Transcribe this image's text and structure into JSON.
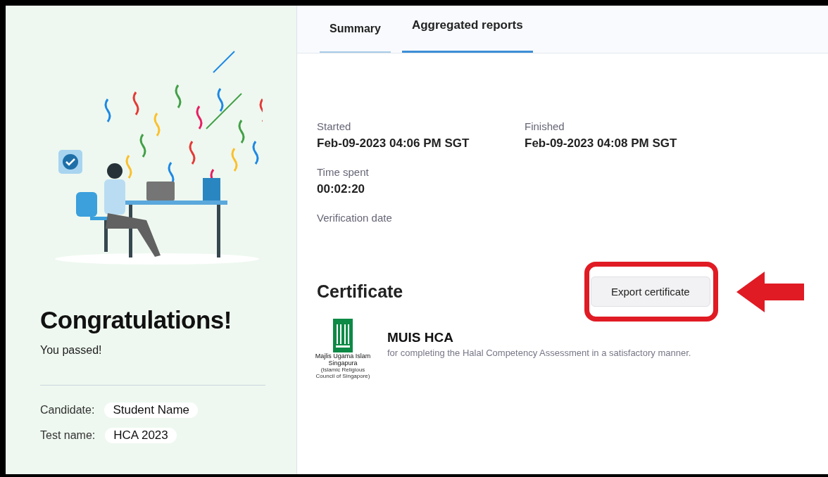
{
  "result": {
    "title": "Congratulations!",
    "subtitle": "You passed!",
    "details": [
      {
        "label": "Candidate:",
        "value": "Student Name"
      },
      {
        "label": "Test name:",
        "value": "HCA 2023"
      }
    ]
  },
  "tabs": [
    {
      "label": "Summary",
      "selected": false
    },
    {
      "label": "Aggregated reports",
      "selected": true
    }
  ],
  "summary": {
    "fields": [
      {
        "label": "Started",
        "value": "Feb-09-2023 04:06 PM SGT"
      },
      {
        "label": "Finished",
        "value": "Feb-09-2023 04:08 PM SGT"
      },
      {
        "label": "Time spent",
        "value": "00:02:20"
      },
      {
        "label": "Verification date"
      }
    ]
  },
  "certificate": {
    "heading": "Certificate",
    "export_button": "Export certificate",
    "logo_name": "Majlis Ugama Islam Singapura",
    "logo_subname": "(Islamic Religious Council of Singapore)",
    "name": "MUIS HCA",
    "description": "for completing the Halal Competency Assessment in a satisfactory manner."
  }
}
